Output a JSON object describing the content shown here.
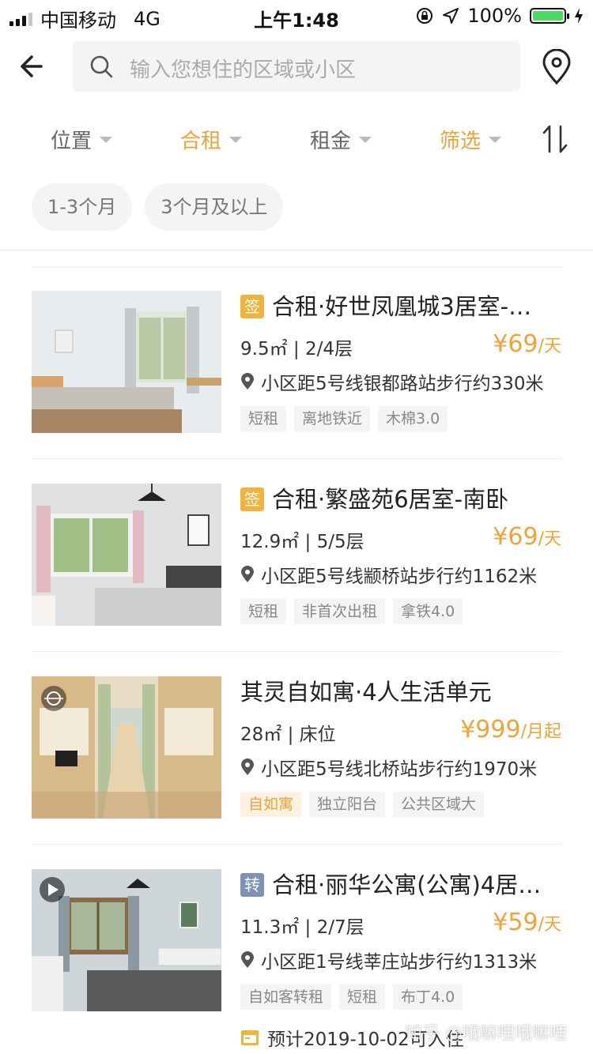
{
  "status_bar": {
    "carrier": "中国移动",
    "network": "4G",
    "time": "上午1:48",
    "battery": "100%"
  },
  "search": {
    "placeholder": "输入您想住的区域或小区"
  },
  "filters": [
    {
      "label": "位置",
      "active": false
    },
    {
      "label": "合租",
      "active": true
    },
    {
      "label": "租金",
      "active": false
    },
    {
      "label": "筛选",
      "active": true
    }
  ],
  "chips": [
    "1-3个月",
    "3个月及以上"
  ],
  "listings": [
    {
      "badge": "签",
      "badge_type": "sign",
      "title": "合租·好世凤凰城3居室-…",
      "meta": "9.5㎡ | 2/4层",
      "price": "¥69",
      "unit": "/天",
      "address": "小区距5号线银都路站步行约330米",
      "tags": [
        {
          "text": "短租",
          "style": "gray"
        },
        {
          "text": "离地铁近",
          "style": "gray"
        },
        {
          "text": "木棉3.0",
          "style": "gray"
        }
      ]
    },
    {
      "badge": "签",
      "badge_type": "sign",
      "title": "合租·繁盛苑6居室-南卧",
      "meta": "12.9㎡ | 5/5层",
      "price": "¥69",
      "unit": "/天",
      "address": "小区距5号线颛桥站步行约1162米",
      "tags": [
        {
          "text": "短租",
          "style": "gray"
        },
        {
          "text": "非首次出租",
          "style": "gray"
        },
        {
          "text": "拿铁4.0",
          "style": "gray"
        }
      ]
    },
    {
      "badge": "",
      "badge_type": "none",
      "title": "其灵自如寓·4人生活单元",
      "meta": "28㎡ | 床位",
      "price": "¥999",
      "unit": "/月起",
      "address": "小区距5号线北桥站步行约1970米",
      "tags": [
        {
          "text": "自如寓",
          "style": "orange"
        },
        {
          "text": "独立阳台",
          "style": "gray"
        },
        {
          "text": "公共区域大",
          "style": "gray"
        }
      ]
    },
    {
      "badge": "转",
      "badge_type": "zhuan",
      "title": "合租·丽华公寓(公寓)4居…",
      "meta": "11.3㎡ | 2/7层",
      "price": "¥59",
      "unit": "/天",
      "address": "小区距1号线莘庄站步行约1313米",
      "tags": [
        {
          "text": "自如客转租",
          "style": "gray"
        },
        {
          "text": "短租",
          "style": "gray"
        },
        {
          "text": "布丁4.0",
          "style": "gray"
        }
      ]
    }
  ],
  "bottom_note": "预计2019-10-02可入住",
  "watermark": "知乎 @哦嘛哩哦嘛哩",
  "colors": {
    "accent": "#f0a33a",
    "badge_sign": "#f2b33d",
    "badge_transfer": "#7c93b5"
  }
}
